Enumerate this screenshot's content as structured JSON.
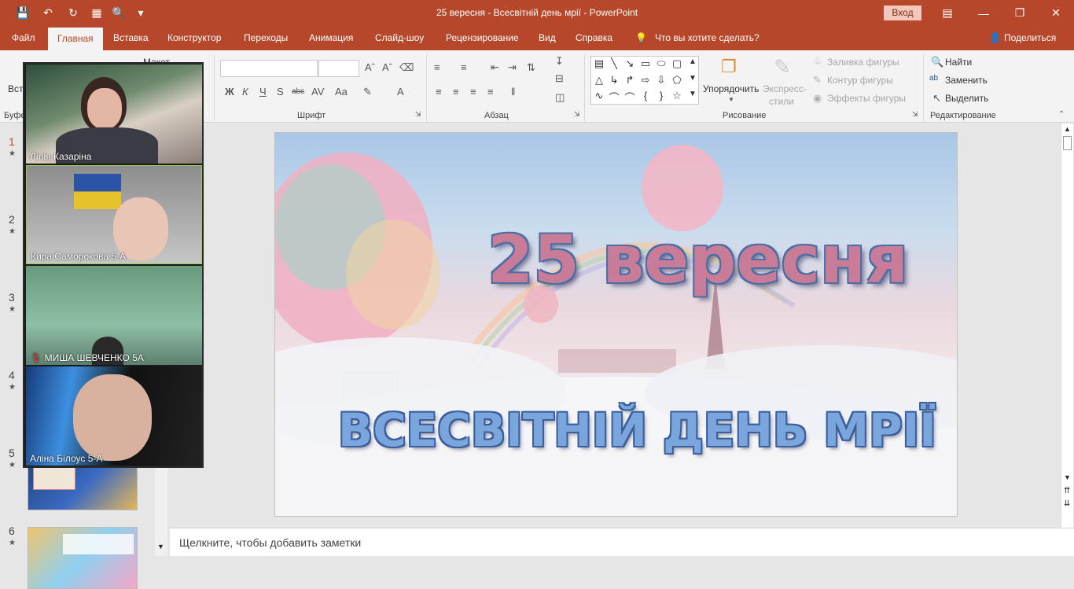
{
  "window": {
    "title": "25 вересня - Всесвітній день мрії  -  PowerPoint",
    "signin_label": "Вход",
    "colors": {
      "accent": "#b7472a",
      "ribbon_bg": "#f3f3f3"
    }
  },
  "tabs": [
    {
      "label": "Файл"
    },
    {
      "label": "Главная"
    },
    {
      "label": "Вставка"
    },
    {
      "label": "Конструктор"
    },
    {
      "label": "Переходы"
    },
    {
      "label": "Анимация"
    },
    {
      "label": "Слайд-шоу"
    },
    {
      "label": "Рецензирование"
    },
    {
      "label": "Вид"
    },
    {
      "label": "Справка"
    }
  ],
  "tell_me": "Что вы хотите сделать?",
  "share_label": "Поделиться",
  "ribbon": {
    "groups": {
      "clipboard_partial": "Буфе",
      "font": "Шрифт",
      "paragraph": "Абзац",
      "drawing": "Рисование",
      "editing": "Редактирование"
    },
    "insert_partial": "Вст",
    "layout_partial": "Макет",
    "arrange": "Упорядочить",
    "quick_styles_1": "Экспресс-",
    "quick_styles_2": "стили",
    "shape_fill": "Заливка фигуры",
    "shape_outline": "Контур фигуры",
    "shape_effects": "Эффекты фигуры",
    "find": "Найти",
    "replace": "Заменить",
    "select": "Выделить",
    "font_btns": {
      "bold": "Ж",
      "italic": "К",
      "underline": "Ч",
      "shadow": "S",
      "strike": "abc",
      "spacing": "AV",
      "case": "Aa",
      "color": "A"
    }
  },
  "slides_numbers": [
    "1",
    "2",
    "3",
    "4",
    "5",
    "6"
  ],
  "video": [
    {
      "name": "Лілія Казаріна"
    },
    {
      "name": "Кира Саморокова 5-А"
    },
    {
      "name": "МИША ШЕВЧЕНКО 5А"
    },
    {
      "name": "Аліна Білоус 5-А"
    }
  ],
  "slide": {
    "title": "25 вересня",
    "subtitle": "ВСЕСВІТНІЙ ДЕНЬ МРІЇ"
  },
  "notes_placeholder": "Щелкните, чтобы добавить заметки"
}
